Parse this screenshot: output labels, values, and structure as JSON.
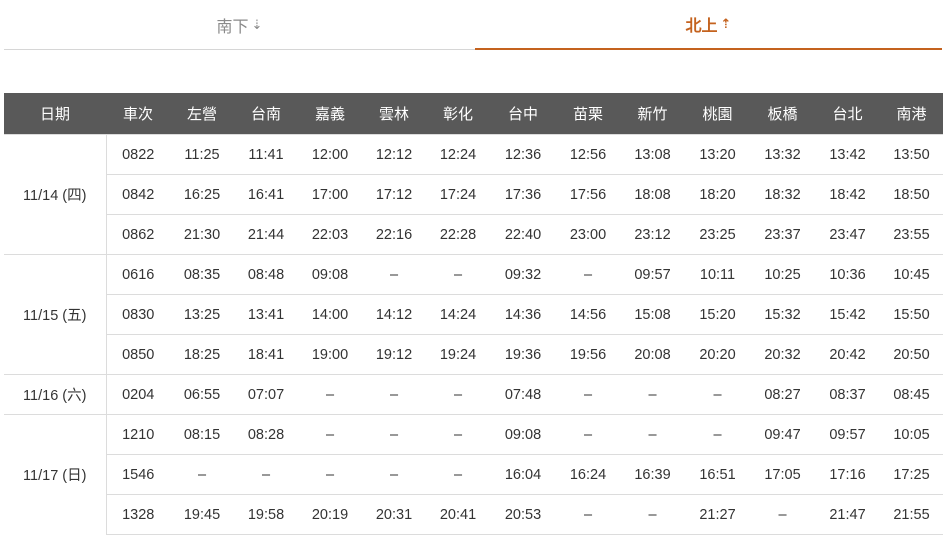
{
  "tabs": {
    "south_label": "南下",
    "south_arrow": "⇣",
    "north_label": "北上",
    "north_arrow": "⇡",
    "active": "north"
  },
  "colors": {
    "accent": "#c4621e",
    "header_bg": "#595959",
    "inactive_tab": "#8a8a8a"
  },
  "table": {
    "headers": [
      "日期",
      "車次",
      "左營",
      "台南",
      "嘉義",
      "雲林",
      "彰化",
      "台中",
      "苗栗",
      "新竹",
      "桃園",
      "板橋",
      "台北",
      "南港"
    ],
    "groups": [
      {
        "date": "11/14 (四)",
        "rows": [
          [
            "0822",
            "11:25",
            "11:41",
            "12:00",
            "12:12",
            "12:24",
            "12:36",
            "12:56",
            "13:08",
            "13:20",
            "13:32",
            "13:42",
            "13:50"
          ],
          [
            "0842",
            "16:25",
            "16:41",
            "17:00",
            "17:12",
            "17:24",
            "17:36",
            "17:56",
            "18:08",
            "18:20",
            "18:32",
            "18:42",
            "18:50"
          ],
          [
            "0862",
            "21:30",
            "21:44",
            "22:03",
            "22:16",
            "22:28",
            "22:40",
            "23:00",
            "23:12",
            "23:25",
            "23:37",
            "23:47",
            "23:55"
          ]
        ]
      },
      {
        "date": "11/15 (五)",
        "rows": [
          [
            "0616",
            "08:35",
            "08:48",
            "09:08",
            "–",
            "–",
            "09:32",
            "–",
            "09:57",
            "10:11",
            "10:25",
            "10:36",
            "10:45"
          ],
          [
            "0830",
            "13:25",
            "13:41",
            "14:00",
            "14:12",
            "14:24",
            "14:36",
            "14:56",
            "15:08",
            "15:20",
            "15:32",
            "15:42",
            "15:50"
          ],
          [
            "0850",
            "18:25",
            "18:41",
            "19:00",
            "19:12",
            "19:24",
            "19:36",
            "19:56",
            "20:08",
            "20:20",
            "20:32",
            "20:42",
            "20:50"
          ]
        ]
      },
      {
        "date": "11/16 (六)",
        "rows": [
          [
            "0204",
            "06:55",
            "07:07",
            "–",
            "–",
            "–",
            "07:48",
            "–",
            "–",
            "–",
            "08:27",
            "08:37",
            "08:45"
          ]
        ]
      },
      {
        "date": "11/17 (日)",
        "rows": [
          [
            "1210",
            "08:15",
            "08:28",
            "–",
            "–",
            "–",
            "09:08",
            "–",
            "–",
            "–",
            "09:47",
            "09:57",
            "10:05"
          ],
          [
            "1546",
            "–",
            "–",
            "–",
            "–",
            "–",
            "16:04",
            "16:24",
            "16:39",
            "16:51",
            "17:05",
            "17:16",
            "17:25"
          ],
          [
            "1328",
            "19:45",
            "19:58",
            "20:19",
            "20:31",
            "20:41",
            "20:53",
            "–",
            "–",
            "21:27",
            "–",
            "21:47",
            "21:55"
          ]
        ]
      }
    ]
  }
}
